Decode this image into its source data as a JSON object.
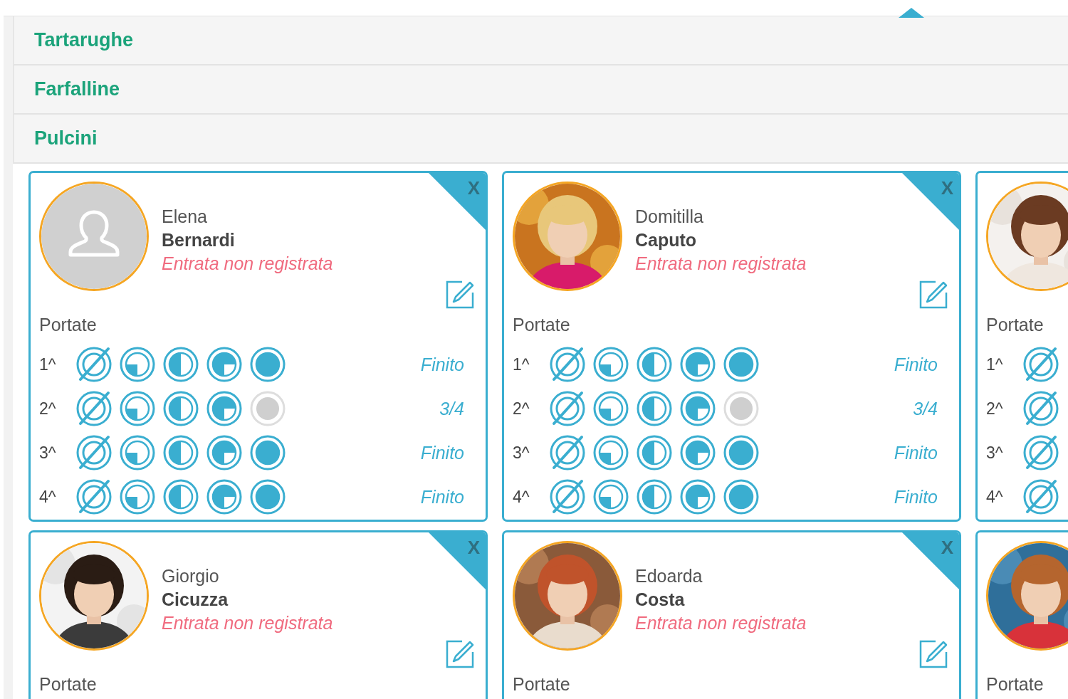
{
  "groups": [
    {
      "title": "Tartarughe"
    },
    {
      "title": "Farfalline"
    },
    {
      "title": "Pulcini",
      "cards": [
        {
          "first_name": "Elena",
          "last_name": "Bernardi",
          "status": "Entrata non registrata",
          "close": "X",
          "avatar": {
            "kind": "placeholder"
          },
          "portate_label": "Portate",
          "courses": [
            {
              "label": "1^",
              "portions": [
                {
                  "on": true
                },
                {
                  "on": true
                },
                {
                  "on": true
                },
                {
                  "on": true
                },
                {
                  "on": true
                }
              ],
              "reading": "Finito"
            },
            {
              "label": "2^",
              "portions": [
                {
                  "on": true
                },
                {
                  "on": true
                },
                {
                  "on": true
                },
                {
                  "on": true
                },
                {
                  "on": false
                }
              ],
              "reading": "3/4"
            },
            {
              "label": "3^",
              "portions": [
                {
                  "on": true
                },
                {
                  "on": true
                },
                {
                  "on": true
                },
                {
                  "on": true
                },
                {
                  "on": true
                }
              ],
              "reading": "Finito"
            },
            {
              "label": "4^",
              "portions": [
                {
                  "on": true
                },
                {
                  "on": true
                },
                {
                  "on": true
                },
                {
                  "on": true
                },
                {
                  "on": true
                }
              ],
              "reading": "Finito"
            }
          ]
        },
        {
          "first_name": "Domitilla",
          "last_name": "Caputo",
          "status": "Entrata non registrata",
          "close": "X",
          "avatar": {
            "kind": "picture"
          },
          "portate_label": "Portate",
          "courses": [
            {
              "label": "1^",
              "portions": [
                {
                  "on": true
                },
                {
                  "on": true
                },
                {
                  "on": true
                },
                {
                  "on": true
                },
                {
                  "on": true
                }
              ],
              "reading": "Finito"
            },
            {
              "label": "2^",
              "portions": [
                {
                  "on": true
                },
                {
                  "on": true
                },
                {
                  "on": true
                },
                {
                  "on": true
                },
                {
                  "on": false
                }
              ],
              "reading": "3/4"
            },
            {
              "label": "3^",
              "portions": [
                {
                  "on": true
                },
                {
                  "on": true
                },
                {
                  "on": true
                },
                {
                  "on": true
                },
                {
                  "on": true
                }
              ],
              "reading": "Finito"
            },
            {
              "label": "4^",
              "portions": [
                {
                  "on": true
                },
                {
                  "on": true
                },
                {
                  "on": true
                },
                {
                  "on": true
                },
                {
                  "on": true
                }
              ],
              "reading": "Finito"
            }
          ]
        },
        {
          "avatar": {
            "kind": "picture"
          },
          "portate_label": "Portate",
          "courses": [
            {
              "label": "1^",
              "portions": [
                {
                  "on": true
                }
              ]
            },
            {
              "label": "2^",
              "portions": [
                {
                  "on": true
                }
              ]
            },
            {
              "label": "3^",
              "portions": [
                {
                  "on": true
                }
              ]
            },
            {
              "label": "4^",
              "portions": [
                {
                  "on": true
                }
              ]
            }
          ]
        },
        {
          "first_name": "Giorgio",
          "last_name": "Cicuzza",
          "status": "Entrata non registrata",
          "close": "X",
          "avatar": {
            "kind": "picture"
          },
          "portate_label": "Portate"
        },
        {
          "first_name": "Edoarda",
          "last_name": "Costa",
          "status": "Entrata non registrata",
          "close": "X",
          "avatar": {
            "kind": "picture"
          },
          "portate_label": "Portate"
        },
        {
          "avatar": {
            "kind": "picture"
          },
          "portate_label": "Portate"
        }
      ]
    }
  ]
}
